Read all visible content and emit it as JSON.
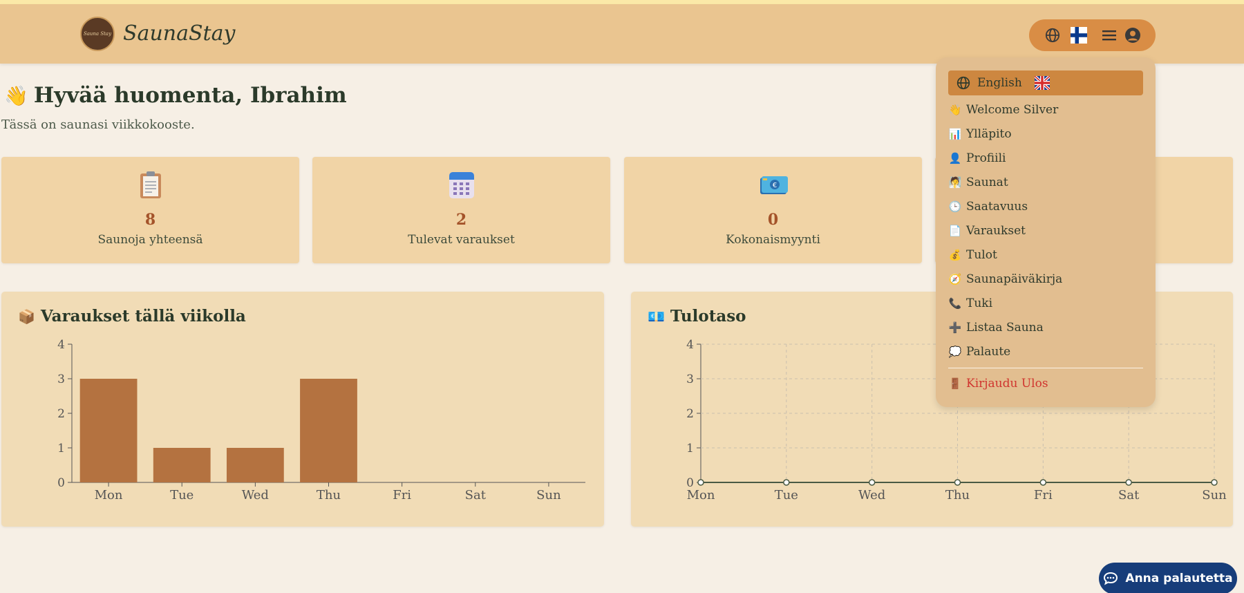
{
  "app": {
    "brand": "SaunaStay",
    "logo_text": "Sauna Stay"
  },
  "header": {
    "icons": [
      "globe-icon",
      "finland-flag-icon",
      "hamburger-menu-icon",
      "user-circle-icon"
    ]
  },
  "greeting": {
    "emoji": "👋",
    "title": "Hyvää huomenta, Ibrahim",
    "subtitle": "Tässä on saunasi viikkokooste."
  },
  "stats": [
    {
      "icon": "📋",
      "value": "8",
      "label": "Saunoja yhteensä"
    },
    {
      "icon": "📅",
      "value": "2",
      "label": "Tulevat varaukset"
    },
    {
      "icon": "💶",
      "value": "0",
      "label": "Kokonaismyynti"
    }
  ],
  "charts": {
    "bookings_title_icon": "📦",
    "bookings_title": "Varaukset tällä viikolla",
    "revenue_title_icon": "💶",
    "revenue_title": "Tulotaso"
  },
  "chart_data": [
    {
      "type": "bar",
      "title": "Varaukset tällä viikolla",
      "categories": [
        "Mon",
        "Tue",
        "Wed",
        "Thu",
        "Fri",
        "Sat",
        "Sun"
      ],
      "values": [
        3,
        1,
        1,
        3,
        0,
        0,
        0
      ],
      "yticks": [
        0,
        1,
        2,
        3,
        4
      ],
      "ylim": [
        0,
        4
      ],
      "color": "#b47240",
      "grid": false
    },
    {
      "type": "line",
      "title": "Tulotaso",
      "categories": [
        "Mon",
        "Tue",
        "Wed",
        "Thu",
        "Fri",
        "Sat",
        "Sun"
      ],
      "values": [
        0,
        0,
        0,
        0,
        0,
        0,
        0
      ],
      "yticks": [
        0,
        1,
        2,
        3,
        4
      ],
      "ylim": [
        0,
        4
      ],
      "color": "#4a5a44",
      "grid": true
    }
  ],
  "menu": {
    "language": {
      "label": "English"
    },
    "items": [
      {
        "icon": "👋",
        "label": "Welcome Silver"
      },
      {
        "icon": "📊",
        "label": "Ylläpito"
      },
      {
        "icon": "👤",
        "label": "Profiili"
      },
      {
        "icon": "🧖",
        "label": "Saunat"
      },
      {
        "icon": "🕒",
        "label": "Saatavuus"
      },
      {
        "icon": "📄",
        "label": "Varaukset"
      },
      {
        "icon": "💰",
        "label": "Tulot"
      },
      {
        "icon": "🧭",
        "label": "Saunapäiväkirja"
      },
      {
        "icon": "📞",
        "label": "Tuki"
      },
      {
        "icon": "➕",
        "label": "Listaa Sauna"
      },
      {
        "icon": "💭",
        "label": "Palaute"
      }
    ],
    "logout": {
      "icon": "🚪",
      "label": "Kirjaudu Ulos"
    }
  },
  "feedback_button": {
    "label": "Anna palautetta"
  },
  "colors": {
    "header": "#eac590",
    "accent": "#cd8740",
    "bar": "#b47240",
    "logout": "#d0352f",
    "feedback": "#173d7a"
  }
}
